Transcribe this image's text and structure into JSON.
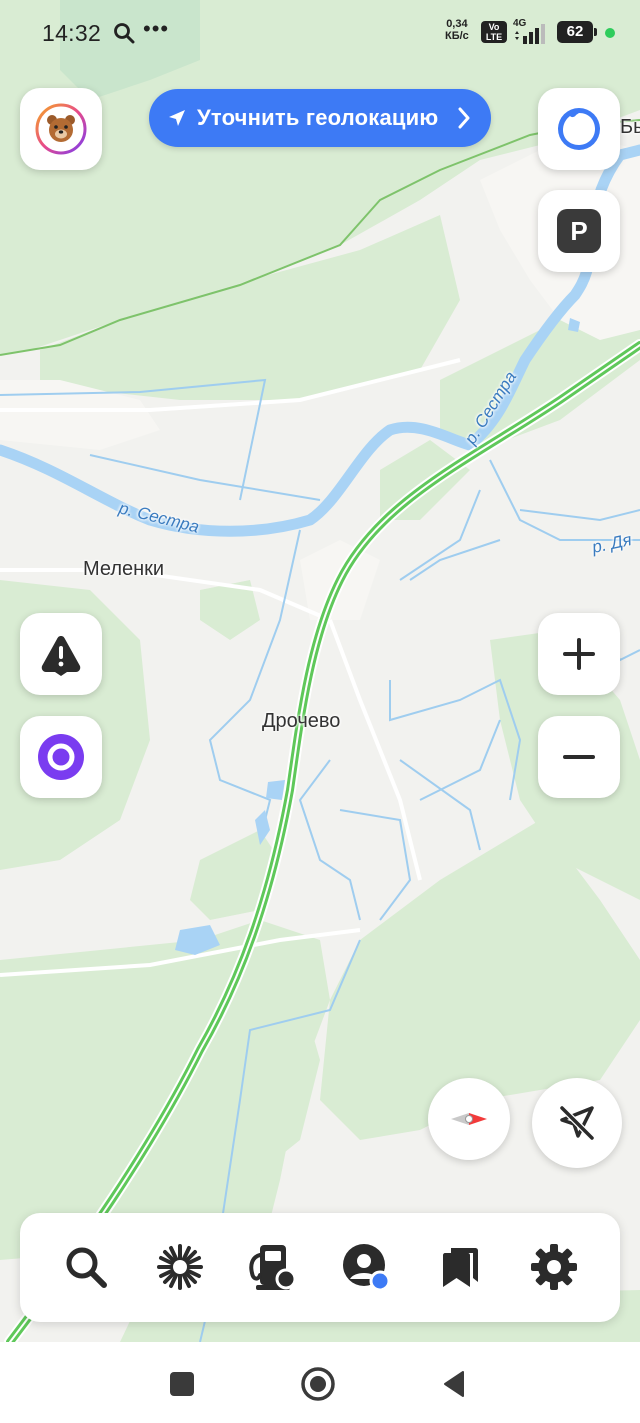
{
  "status_bar": {
    "time": "14:32",
    "speed_value": "0,34",
    "speed_unit": "КБ/с",
    "volte_top": "Vo",
    "volte_bottom": "LTE",
    "network": "4G",
    "battery": "62"
  },
  "top": {
    "geolocation_button": "Уточнить геолокацию",
    "edge_label": "Бы"
  },
  "map_labels": {
    "river_1": "р. Сестра",
    "river_2": "р. Сестра",
    "river_3": "р. Дя",
    "village_1": "Меленки",
    "village_2": "Дрочево"
  },
  "colors": {
    "accent": "#3d7af5",
    "forest": "#d9ecd3",
    "open_land": "#f2f2ef",
    "water": "#a9d3f5",
    "highway": "#5fc85a",
    "alice": "#7a3cf0"
  },
  "icons": {
    "avatar": "bear-avatar-icon",
    "alice": "alice-icon",
    "parking": "parking-icon",
    "incident": "warning-icon",
    "zoom_in": "plus-icon",
    "zoom_out": "minus-icon",
    "compass": "compass-icon",
    "follow": "location-arrow-off-icon",
    "search": "search-icon",
    "discovery": "sparkle-icon",
    "fuel": "fuel-icon",
    "profile": "profile-icon",
    "bookmarks": "bookmarks-icon",
    "settings": "gear-icon"
  }
}
